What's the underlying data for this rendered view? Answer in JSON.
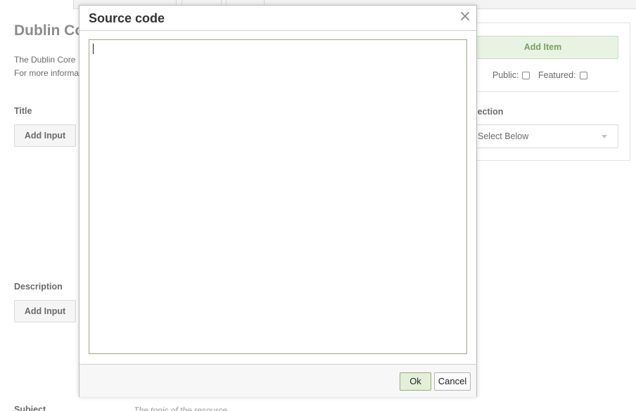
{
  "page": {
    "title": "Dublin Co",
    "intro_line1": "The Dublin Core",
    "intro_line2": "For more informa"
  },
  "fields": [
    {
      "label": "Title",
      "button": "Add Input"
    },
    {
      "label": "Description",
      "button": "Add Input"
    },
    {
      "label": "Subject",
      "hint": "The topic of the resource"
    }
  ],
  "panel": {
    "add_item": "Add Item",
    "public_label": "Public:",
    "featured_label": "Featured:",
    "public_checked": false,
    "featured_checked": false,
    "collection_label": "ollection",
    "collection_select": "Select Below"
  },
  "dialog": {
    "title": "Source code",
    "code": "",
    "ok_label": "Ok",
    "cancel_label": "Cancel",
    "close_icon": "close-icon"
  },
  "colors": {
    "ok_border": "#94ad79",
    "ok_fill": "#e4efd8",
    "add_item_fill": "#e9f3e3",
    "add_item_text": "#78a05c",
    "textarea_border": "#9aab83"
  }
}
